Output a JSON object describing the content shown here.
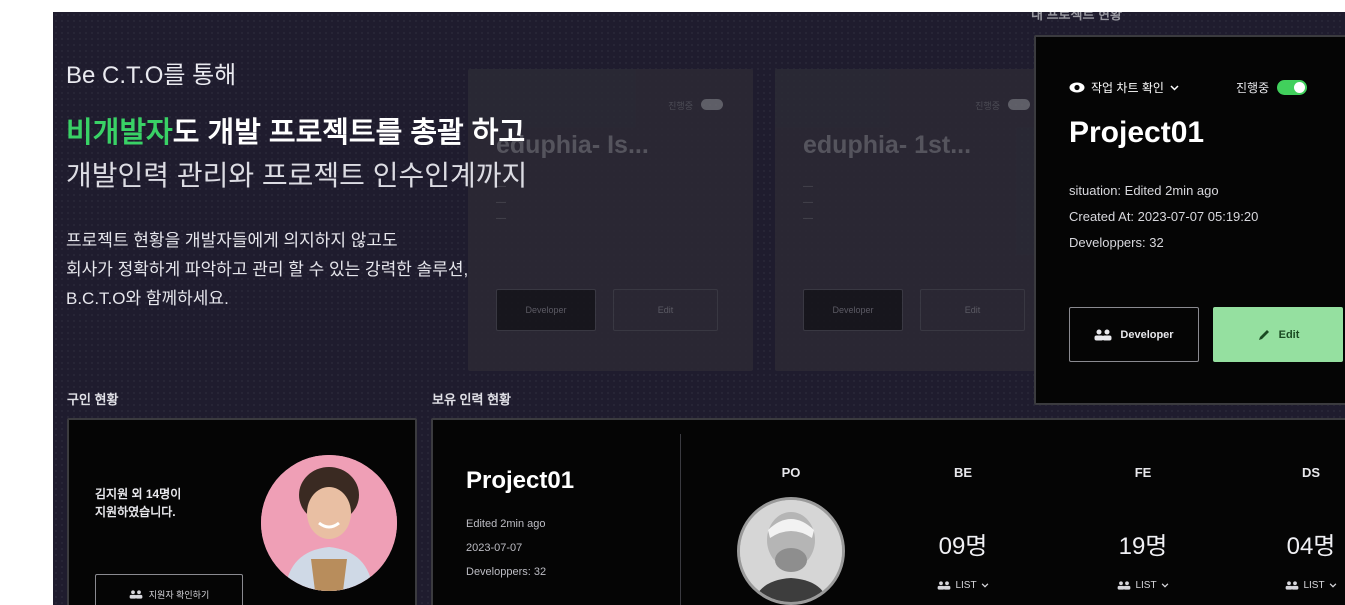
{
  "hero": {
    "subtitle": "Be C.T.O를 통해",
    "title_accent": "비개발자",
    "title_rest": "도 개발 프로젝트를 총괄 하고",
    "line2": "개발인력 관리와 프로젝트 인수인계까지",
    "desc_line1": "프로젝트 현황을 개발자들에게 의지하지 않고도",
    "desc_line2": "회사가 정확하게 파악하고 관리 할 수 있는 강력한 솔루션,",
    "desc_line3": "B.C.T.O와 함께하세요."
  },
  "ghost_cards": [
    {
      "title": "eduphia- Is...",
      "label": "진행중",
      "btn1": "Developer",
      "btn2": "Edit"
    },
    {
      "title": "eduphia- 1st...",
      "label": "진행중",
      "btn1": "Developer",
      "btn2": "Edit"
    }
  ],
  "project_panel": {
    "label": "내 프로젝트 현황",
    "view_toggle": "작업 차트 확인",
    "status": "진행중",
    "title": "Project01",
    "situation": "situation: Edited 2min ago",
    "created": "Created At: 2023-07-07 05:19:20",
    "developers": "Developpers: 32",
    "developer_btn": "Developer",
    "edit_btn": "Edit"
  },
  "recruit": {
    "section_label": "구인 현황",
    "text_line1": "김지원 외 14명이",
    "text_line2": "지원하였습니다.",
    "button": "지원자 확인하기"
  },
  "staff": {
    "section_label": "보유 인력 현황",
    "title": "Project01",
    "edited": "Edited 2min ago",
    "date": "2023-07-07",
    "developers": "Developpers: 32",
    "columns": [
      {
        "head": "PO"
      },
      {
        "head": "BE",
        "count": "09명",
        "list": "LIST"
      },
      {
        "head": "FE",
        "count": "19명",
        "list": "LIST"
      },
      {
        "head": "DS",
        "count": "04명",
        "list": "LIST"
      }
    ]
  },
  "colors": {
    "accent_green": "#39d266",
    "toggle_green": "#41d05c",
    "edit_button": "#95e0a0",
    "background": "#1f1c2e"
  }
}
